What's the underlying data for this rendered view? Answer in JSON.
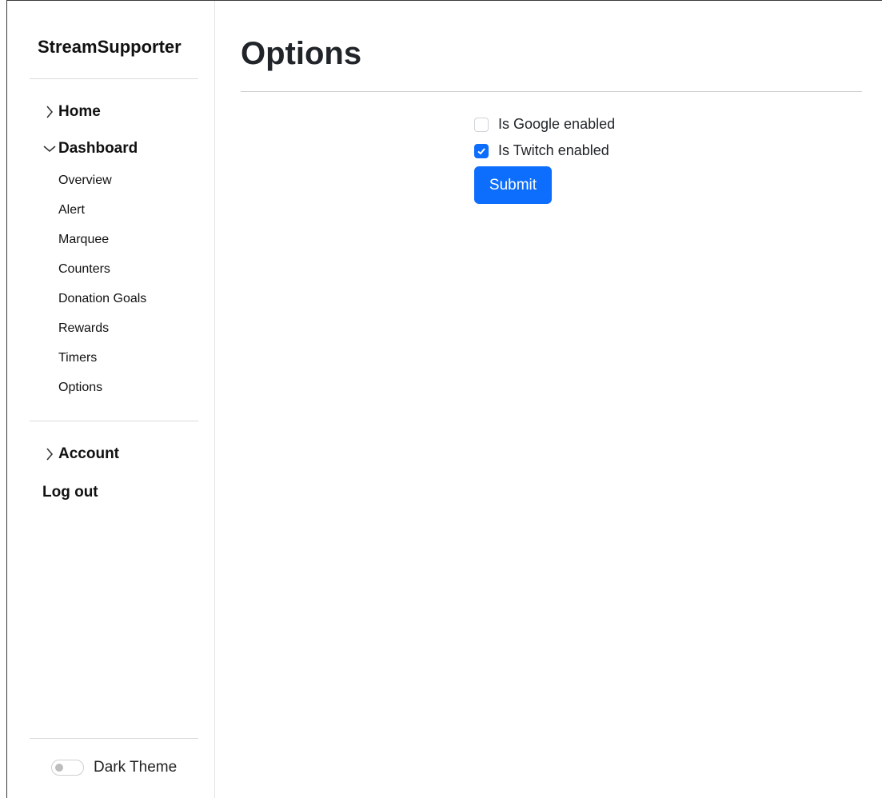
{
  "sidebar": {
    "brand": "StreamSupporter",
    "home": "Home",
    "dashboard": "Dashboard",
    "dashboard_items": [
      "Overview",
      "Alert",
      "Marquee",
      "Counters",
      "Donation Goals",
      "Rewards",
      "Timers",
      "Options"
    ],
    "account": "Account",
    "logout": "Log out",
    "theme_label": "Dark Theme",
    "theme_on": false
  },
  "main": {
    "title": "Options",
    "options": [
      {
        "label": "Is Google enabled",
        "checked": false
      },
      {
        "label": "Is Twitch enabled",
        "checked": true
      }
    ],
    "submit_label": "Submit"
  },
  "colors": {
    "primary": "#0d6efd",
    "text": "#212529"
  },
  "icons": {
    "home": "chevron-right-icon",
    "dashboard": "chevron-down-icon",
    "account": "chevron-right-icon"
  }
}
